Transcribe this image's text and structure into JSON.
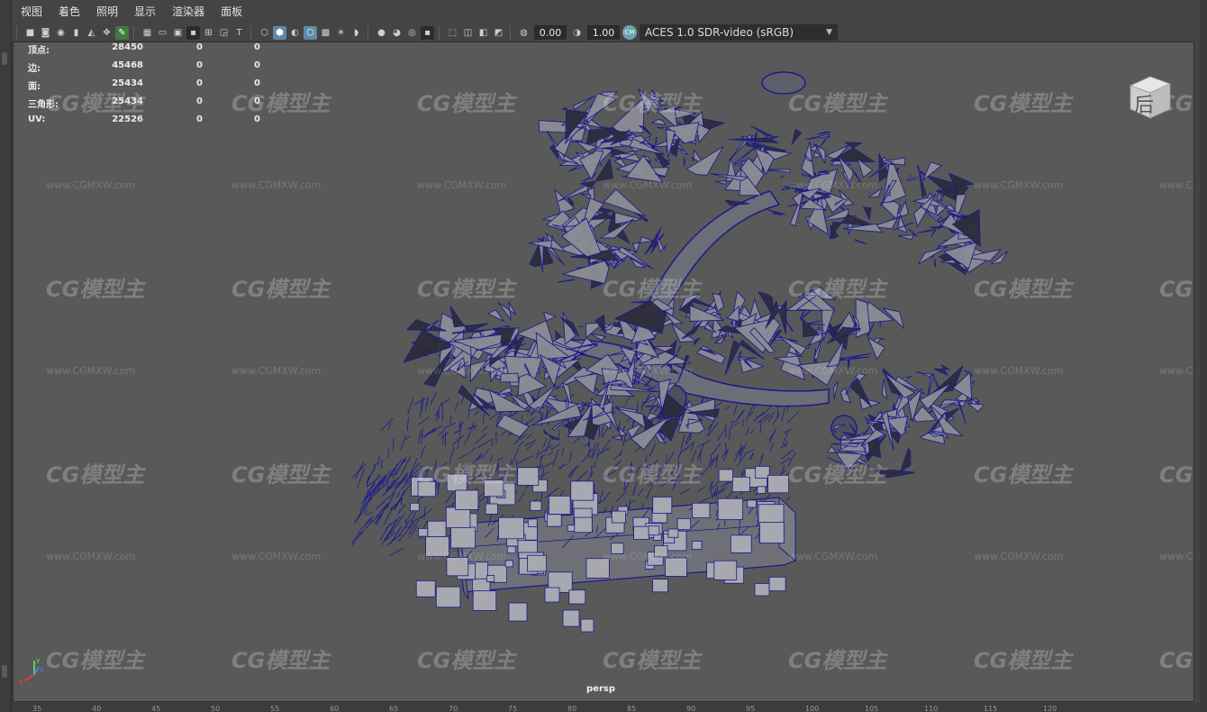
{
  "menu": [
    "视图",
    "着色",
    "照明",
    "显示",
    "渲染器",
    "面板"
  ],
  "toolbar": {
    "exposure": "0.00",
    "gamma": "1.00",
    "color_management_badge": "CM",
    "color_space": "ACES 1.0 SDR-video (sRGB)"
  },
  "hud": [
    {
      "label": "顶点:",
      "v1": "28450",
      "v2": "0",
      "v3": "0"
    },
    {
      "label": "边:",
      "v1": "45468",
      "v2": "0",
      "v3": "0"
    },
    {
      "label": "面:",
      "v1": "25434",
      "v2": "0",
      "v3": "0"
    },
    {
      "label": "三角形:",
      "v1": "25434",
      "v2": "0",
      "v3": "0"
    },
    {
      "label": "UV:",
      "v1": "22526",
      "v2": "0",
      "v3": "0"
    }
  ],
  "camera_label": "persp",
  "viewcube_label": "后",
  "watermark": {
    "logo": "CG模型主",
    "url": "www.CGMXW.com"
  },
  "axis_labels": {
    "x": "x",
    "y": "y",
    "z": "z"
  },
  "timeline_ticks": [
    "35",
    "40",
    "45",
    "50",
    "55",
    "60",
    "65",
    "70",
    "75",
    "80",
    "85",
    "90",
    "95",
    "100",
    "105",
    "110",
    "115",
    "120"
  ],
  "colors": {
    "wireframe": "#1a1a8c",
    "mesh_fill": "#8c8c96",
    "viewport_bg": "#595959",
    "toolbar_highlight": "#5d8aa8"
  }
}
